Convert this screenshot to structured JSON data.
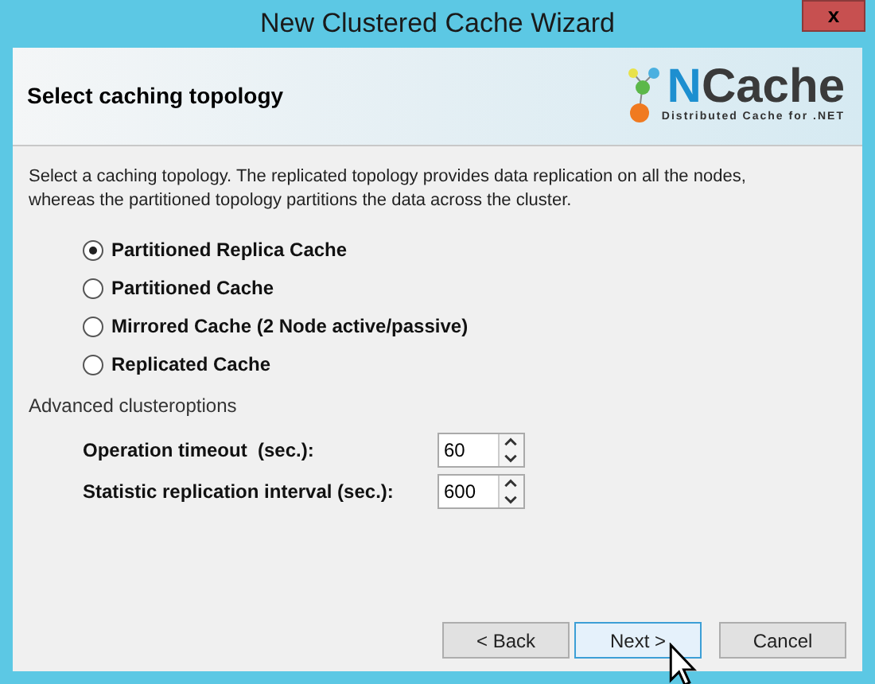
{
  "window": {
    "title": "New Clustered Cache Wizard",
    "close": "x"
  },
  "header": {
    "title": "Select caching topology",
    "logo": {
      "accent": "N",
      "name": "Cache",
      "tagline": "Distributed Cache for .NET"
    }
  },
  "description": "Select a caching topology. The replicated topology provides data replication on all the nodes, whereas the partitioned topology partitions the data across the cluster.",
  "topologies": [
    {
      "label": "Partitioned Replica Cache",
      "selected": true
    },
    {
      "label": "Partitioned Cache",
      "selected": false
    },
    {
      "label": "Mirrored Cache (2 Node active/passive)",
      "selected": false
    },
    {
      "label": "Replicated Cache",
      "selected": false
    }
  ],
  "advanced": {
    "title": "Advanced clusteroptions",
    "fields": [
      {
        "label": "Operation timeout  (sec.):",
        "value": "60"
      },
      {
        "label": "Statistic replication interval (sec.):",
        "value": "600"
      }
    ]
  },
  "buttons": [
    {
      "label": "< Back",
      "focused": false
    },
    {
      "label": "Next >",
      "focused": true
    },
    {
      "label": "Cancel",
      "focused": false
    }
  ]
}
